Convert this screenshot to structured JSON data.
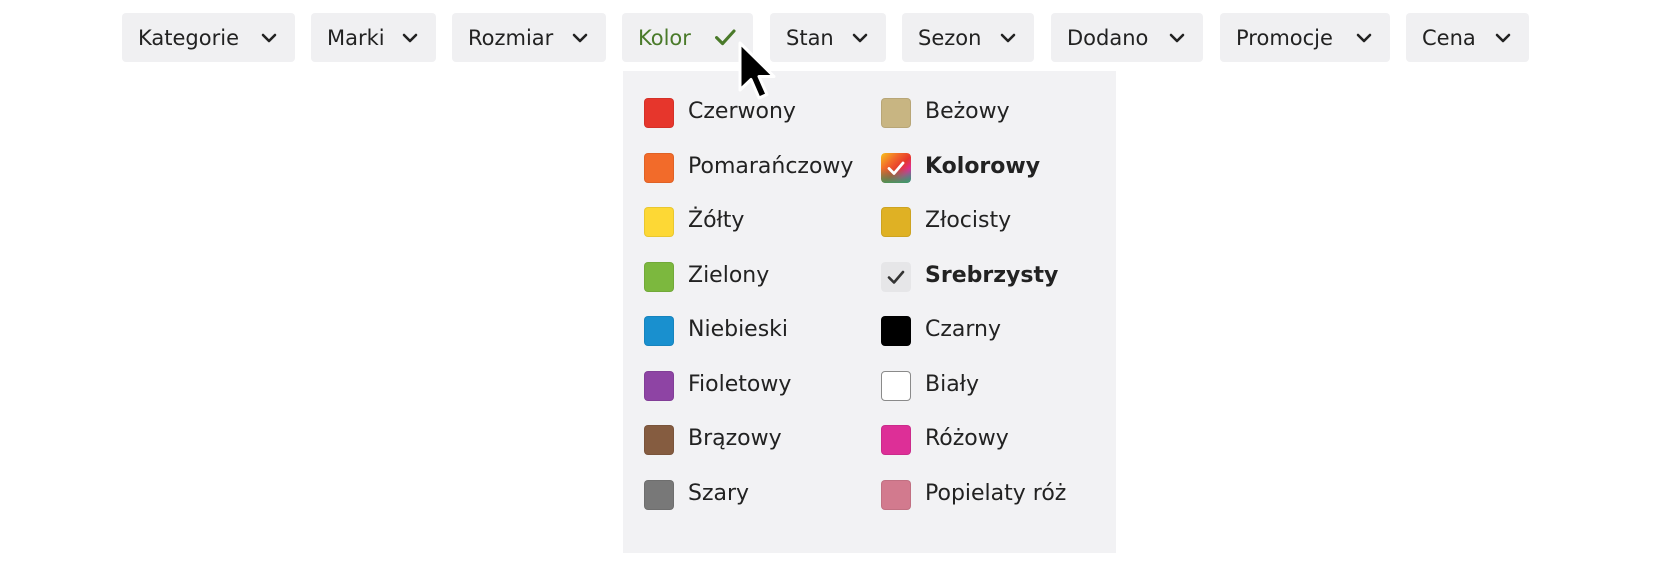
{
  "filters": [
    {
      "label": "Kategorie",
      "active": false
    },
    {
      "label": "Marki",
      "active": false
    },
    {
      "label": "Rozmiar",
      "active": false
    },
    {
      "label": "Kolor",
      "active": true
    },
    {
      "label": "Stan",
      "active": false
    },
    {
      "label": "Sezon",
      "active": false
    },
    {
      "label": "Dodano",
      "active": false
    },
    {
      "label": "Promocje",
      "active": false
    },
    {
      "label": "Cena",
      "active": false
    }
  ],
  "colors": {
    "active_filter_text": "#4a7a2a",
    "button_bg": "#f0f0f2",
    "dropdown_bg": "#f2f2f4"
  },
  "color_options": {
    "left": [
      {
        "label": "Czerwony",
        "swatch": "#e6362c"
      },
      {
        "label": "Pomarańczowy",
        "swatch": "#f26b2a"
      },
      {
        "label": "Żółty",
        "swatch": "#fdd835"
      },
      {
        "label": "Zielony",
        "swatch": "#7cb83e"
      },
      {
        "label": "Niebieski",
        "swatch": "#1990cf"
      },
      {
        "label": "Fioletowy",
        "swatch": "#8e44a4"
      },
      {
        "label": "Brązowy",
        "swatch": "#855c40"
      },
      {
        "label": "Szary",
        "swatch": "#787878"
      }
    ],
    "right": [
      {
        "label": "Beżowy",
        "swatch": "#c8b582"
      },
      {
        "label": "Kolorowy",
        "swatch": "rainbow",
        "selected": true
      },
      {
        "label": "Złocisty",
        "swatch": "#dfb124"
      },
      {
        "label": "Srebrzysty",
        "swatch": "#e6e6e8",
        "selected": true
      },
      {
        "label": "Czarny",
        "swatch": "#000000"
      },
      {
        "label": "Biały",
        "swatch": "#ffffff"
      },
      {
        "label": "Różowy",
        "swatch": "#dd2f97"
      },
      {
        "label": "Popielaty róż",
        "swatch": "#d27a8e"
      }
    ]
  }
}
